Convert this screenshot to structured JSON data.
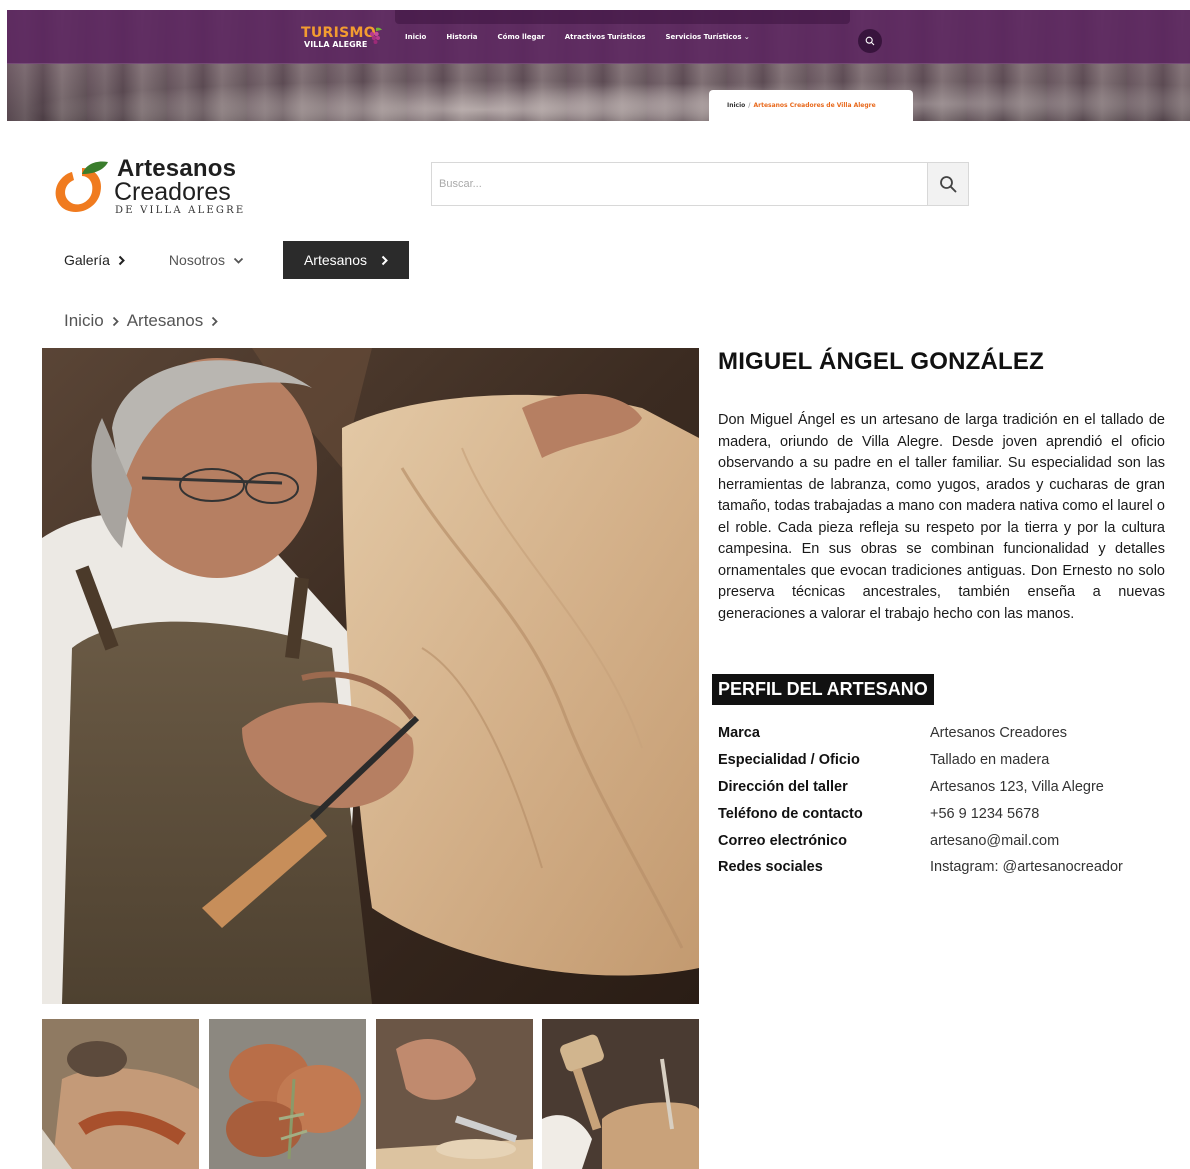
{
  "topbar": {
    "brand_line1": "TURISMO",
    "brand_line2": "VILLA ALEGRE",
    "nav": [
      "Inicio",
      "Historia",
      "Cómo llegar",
      "Atractivos Turísticos",
      "Servicios Turísticos ⌄"
    ],
    "breadcrumb_home": "Inicio",
    "breadcrumb_sep": "/",
    "breadcrumb_current": "Artesanos Creadores de Villa Alegre"
  },
  "logo": {
    "line1": "Artesanos",
    "line2": "Creadores",
    "line3": "DE VILLA ALEGRE"
  },
  "search": {
    "placeholder": "Buscar..."
  },
  "menu": {
    "galeria": "Galería",
    "nosotros": "Nosotros",
    "artesanos": "Artesanos"
  },
  "breadcrumb": {
    "home": "Inicio",
    "current": "Artesanos"
  },
  "artisan": {
    "name": "MIGUEL ÁNGEL GONZÁLEZ",
    "bio": "Don Miguel Ángel es un artesano de larga tradición en el tallado de madera, oriundo de Villa Alegre. Desde joven aprendió el oficio observando a su padre en el taller familiar. Su especialidad son las herramientas de labranza, como yugos, arados y cucharas de gran tamaño, todas trabajadas a mano con madera nativa como el laurel o el roble. Cada pieza refleja su respeto por la tierra y por la cultura campesina. En sus obras se combinan funcionalidad y detalles ornamentales que evocan tradiciones antiguas. Don Ernesto no solo preserva técnicas ancestrales, también enseña a nuevas generaciones a valorar el trabajo hecho con las manos."
  },
  "profile": {
    "heading": "PERFIL DEL ARTESANO",
    "rows": [
      {
        "label": "Marca",
        "value": "Artesanos Creadores"
      },
      {
        "label": "Especialidad / Oficio",
        "value": "Tallado en madera"
      },
      {
        "label": "Dirección del taller",
        "value": "Artesanos 123, Villa Alegre"
      },
      {
        "label": "Teléfono de contacto",
        "value": "+56 9 1234 5678"
      },
      {
        "label": "Correo electrónico",
        "value": "artesano@mail.com"
      },
      {
        "label": "Redes sociales",
        "value": "Instagram: @artesanocreador"
      }
    ]
  },
  "colors": {
    "topbar": "#5c2860",
    "brand_orange": "#f39c30",
    "breadcrumb_accent": "#e8691c",
    "logo_orange": "#f07b1f",
    "logo_green": "#3a7d2c",
    "active_menu": "#2b2b2b"
  },
  "icons": [
    "grape-icon",
    "search-icon",
    "chevron-right-icon",
    "chevron-down-icon",
    "logo-fruit-icon"
  ]
}
